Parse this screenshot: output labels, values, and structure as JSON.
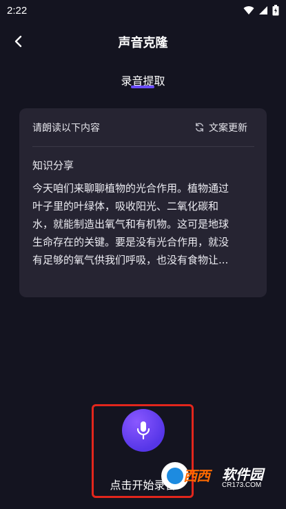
{
  "status_bar": {
    "time": "2:22",
    "icons": [
      "wifi-icon",
      "signal-icon",
      "battery-icon"
    ]
  },
  "header": {
    "title": "声音克隆",
    "back_icon": "chevron-left-icon"
  },
  "tab": {
    "label": "录音提取",
    "accent": "#6a4cff"
  },
  "card": {
    "prompt": "请朗读以下内容",
    "refresh_icon": "refresh-icon",
    "refresh_label": "文案更新",
    "section_title": "知识分享",
    "body": "今天咱们来聊聊植物的光合作用。植物通过\n叶子里的叶绿体，吸收阳光、二氧化碳和\n水，就能制造出氧气和有机物。这可是地球\n生命存在的关键。要是没有光合作用，就没\n有足够的氧气供我们呼吸，也没有食物让..."
  },
  "record": {
    "icon": "microphone-icon",
    "label": "点击开始录音",
    "highlight_color": "#e2261c"
  },
  "watermark": {
    "brand": "西西",
    "name": "软件园",
    "url": "CR173.COM"
  },
  "colors": {
    "background": "#141420",
    "card": "#262432",
    "accent": "#6a4cff"
  }
}
